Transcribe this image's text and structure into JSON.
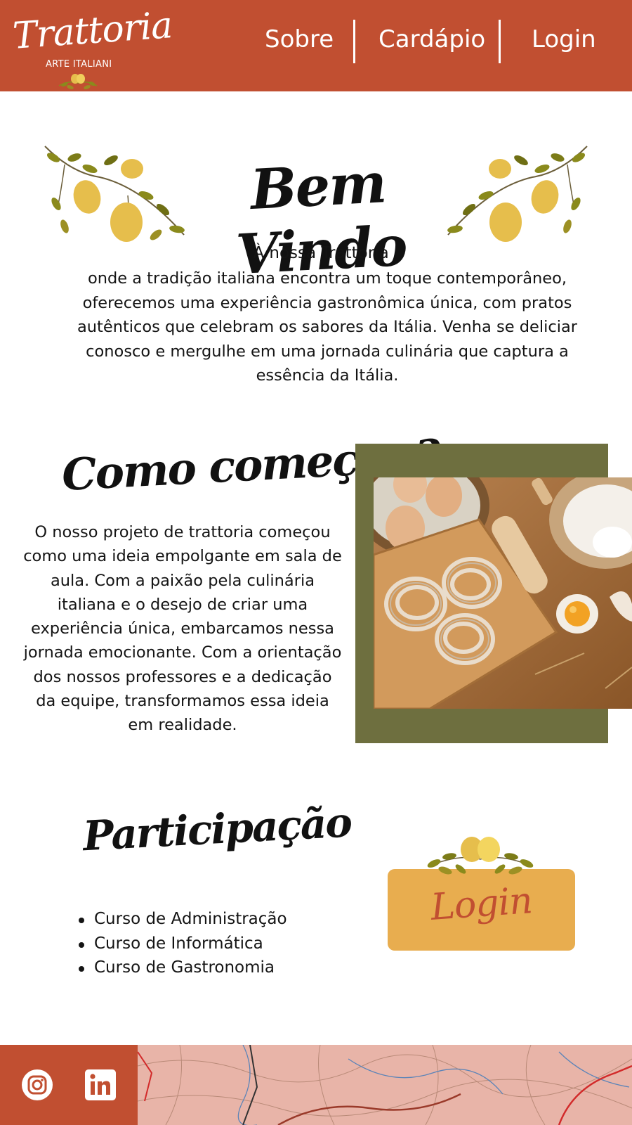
{
  "header": {
    "logo": {
      "name": "Trattoria",
      "tagline": "ARTE ITALIANI"
    },
    "nav": [
      {
        "label": "Sobre"
      },
      {
        "label": "Cardápio"
      },
      {
        "label": "Login"
      }
    ]
  },
  "welcome": {
    "title": "Bem Vindo",
    "subtitle": "À nossa Trattoria",
    "text": "onde a tradição italiana encontra um toque contemporâneo, oferecemos uma experiência gastronômica única, com pratos autênticos que celebram os sabores da Itália. Venha se deliciar conosco e mergulhe em uma jornada culinária que captura a essência da Itália."
  },
  "history": {
    "title": "Como começou?",
    "text": "O nosso projeto de trattoria começou como uma ideia empolgante em sala de aula. Com a paixão pela culinária italiana e o desejo de criar uma experiência única, embarcamos nessa jornada emocionante. Com a orientação dos nossos professores e a dedicação da equipe, transformamos essa ideia em realidade.",
    "photo_icon": "pasta-eggs-flour-photo"
  },
  "participation": {
    "title": "Participação",
    "items": [
      {
        "label": "Curso de Administração"
      },
      {
        "label": "Curso de Informática"
      },
      {
        "label": "Curso de Gastronomia"
      }
    ],
    "login_label": "Login"
  },
  "footer": {
    "social": [
      {
        "icon": "instagram-icon"
      },
      {
        "icon": "linkedin-icon"
      }
    ],
    "map_icon": "map-background"
  },
  "colors": {
    "terracotta": "#c14f31",
    "olive": "#6e6f3f",
    "mustard": "#e8ad4f",
    "lemon": "#e6be4c",
    "leaf": "#8a8a1c",
    "text": "#141414"
  }
}
